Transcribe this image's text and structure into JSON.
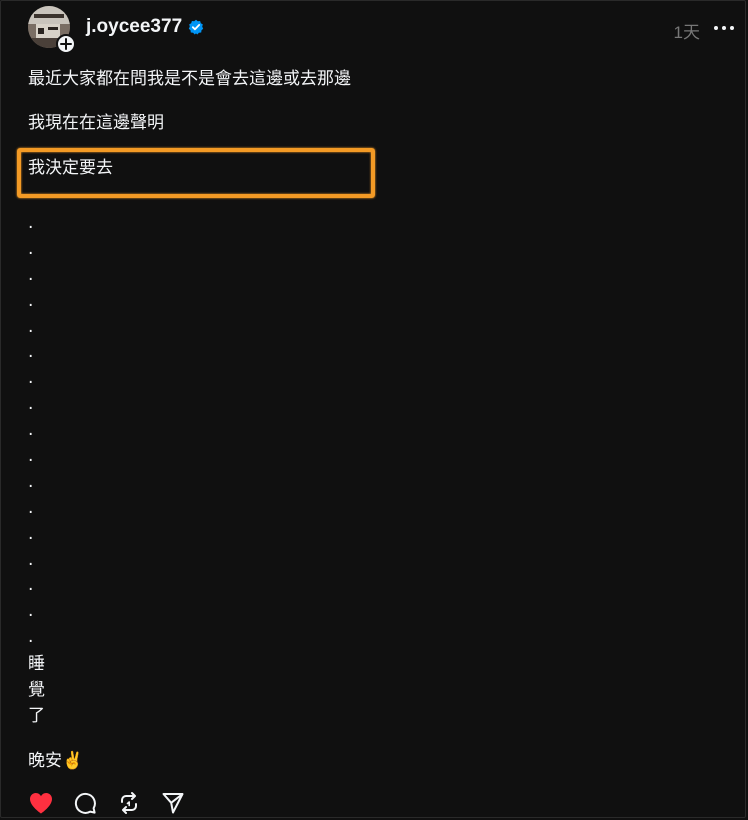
{
  "post": {
    "username": "j.oycee377",
    "timestamp": "1天",
    "verified": true,
    "lines": {
      "line1": "最近大家都在問我是不是會去這邊或去那邊",
      "line2": "我現在在這邊聲明",
      "line3": "我決定要去"
    },
    "dots": [
      ".",
      ".",
      ".",
      ".",
      ".",
      ".",
      ".",
      ".",
      ".",
      ".",
      ".",
      ".",
      ".",
      ".",
      ".",
      ".",
      "."
    ],
    "vertical": [
      "睡",
      "覺",
      "了"
    ],
    "closing": "晚安✌️"
  },
  "header": {
    "avatar_icon": "avatar-photo",
    "follow_icon": "plus-icon",
    "more_icon": "more-horizontal-icon"
  },
  "actions": {
    "like_icon": "heart-icon",
    "liked": true,
    "comment_icon": "comment-icon",
    "repost_icon": "repost-icon",
    "share_icon": "send-icon"
  },
  "colors": {
    "background": "#101010",
    "text": "#f3f5f7",
    "muted": "#777777",
    "verified": "#0095f6",
    "like": "#ff3040",
    "highlight": "#f39a25"
  }
}
